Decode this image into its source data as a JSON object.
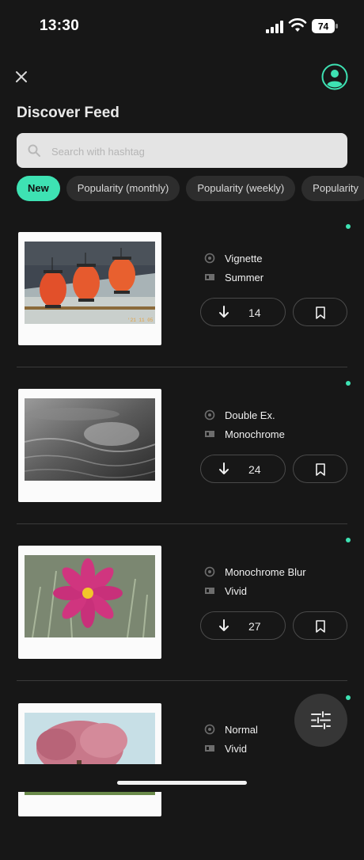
{
  "status": {
    "time": "13:30",
    "battery": "74"
  },
  "header": {
    "title": "Discover Feed"
  },
  "search": {
    "placeholder": "Search with hashtag"
  },
  "chips": [
    "New",
    "Popularity (monthly)",
    "Popularity (weekly)",
    "Popularity"
  ],
  "feed": [
    {
      "effect": "Vignette",
      "filter": "Summer",
      "downloads": "14"
    },
    {
      "effect": "Double Ex.",
      "filter": "Monochrome",
      "downloads": "24"
    },
    {
      "effect": "Monochrome Blur",
      "filter": "Vivid",
      "downloads": "27"
    },
    {
      "effect": "Normal",
      "filter": "Vivid",
      "downloads": ""
    }
  ],
  "colors": {
    "accent": "#3ee2b3",
    "background": "#171717",
    "chip": "#2d2d2d"
  }
}
